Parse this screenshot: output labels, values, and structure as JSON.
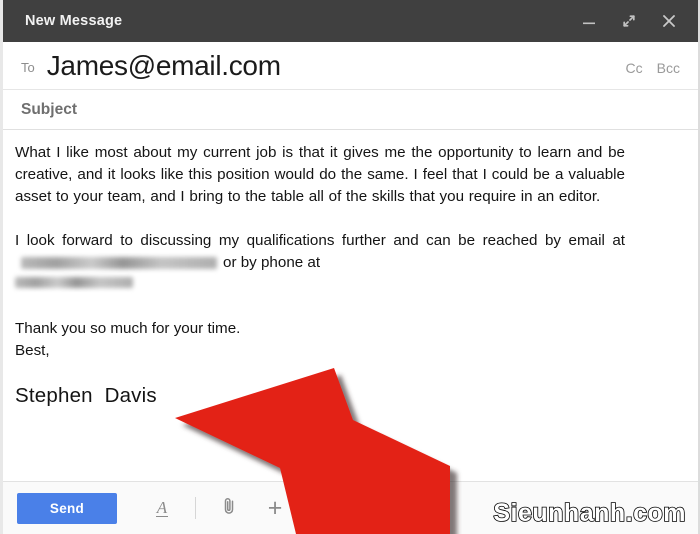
{
  "window": {
    "title": "New Message",
    "controls": [
      {
        "name": "minimize",
        "icon": "minimize-icon"
      },
      {
        "name": "expand",
        "icon": "expand-icon"
      },
      {
        "name": "close",
        "icon": "close-icon"
      }
    ]
  },
  "compose": {
    "to": {
      "label": "To",
      "value": "James@email.com"
    },
    "cc_label": "Cc",
    "bcc_label": "Bcc",
    "subject_placeholder": "Subject",
    "body": {
      "paragraph1": "What I like most about my current job is that it gives me the opportunity to learn and be creative, and it looks like this position would do the same. I feel that I could be a valuable asset to your team, and I bring to the table all of the skills that you require in an editor.",
      "paragraph2_part1": "I look forward to discussing my qualifications further and can be reached by email at",
      "paragraph2_redacted_email": "[redacted email]",
      "paragraph2_part2": "or by phone at",
      "paragraph2_redacted_phone": "[redacted phone]",
      "paragraph3_line1": "Thank you so much for your time.",
      "paragraph3_line2": "Best,",
      "signature": "Stephen  Davis"
    }
  },
  "toolbar": {
    "send_label": "Send",
    "format_icon_label": "A",
    "icons": [
      {
        "name": "format-text-icon"
      },
      {
        "name": "attach-file-icon"
      },
      {
        "name": "insert-more-icon"
      }
    ]
  },
  "annotation": {
    "arrow_color": "#e32119",
    "arrow_shadow_color": "#3c3230",
    "arrow_direction": "up-left"
  },
  "watermark": {
    "text": "Sieunhanh.com"
  },
  "colors": {
    "titlebar_bg": "#404040",
    "send_button_bg": "#4a80e8",
    "body_text": "#141414",
    "muted_text": "#8d8d8d",
    "toolbar_bg": "#fafafa"
  }
}
